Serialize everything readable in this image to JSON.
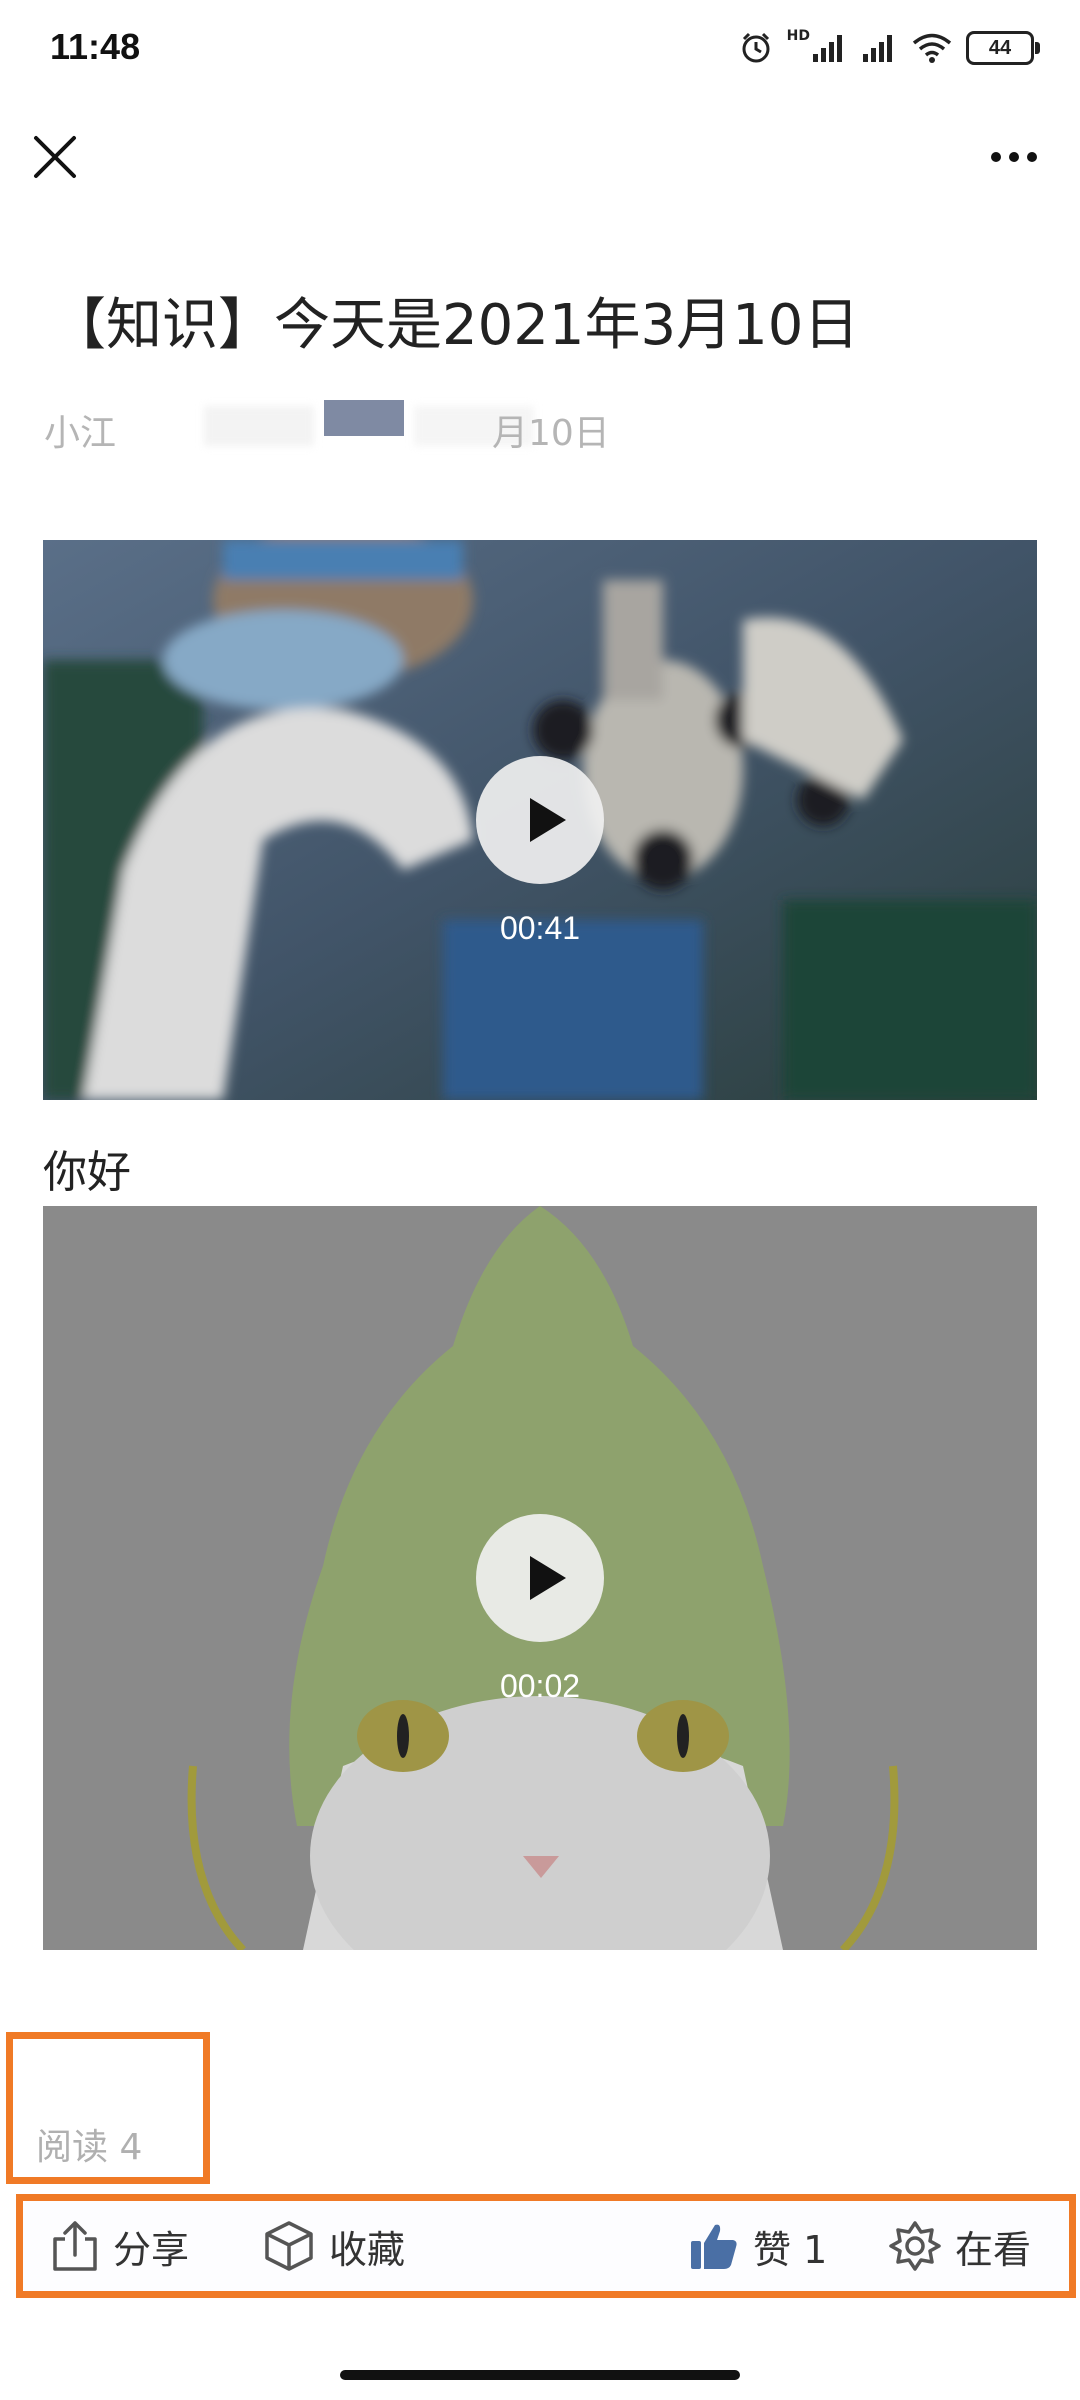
{
  "status_bar": {
    "time": "11:48",
    "hd_label": "HD",
    "battery": "44"
  },
  "header": {
    "close_icon": "close-icon",
    "more_icon": "more-icon"
  },
  "article": {
    "title": "【知识】今天是2021年3月10日",
    "author": "小江",
    "date": "月10日"
  },
  "videos": [
    {
      "duration": "00:41",
      "scene": "surgeon-with-microscope"
    },
    {
      "duration": "00:02",
      "scene": "cat-in-green-hat"
    }
  ],
  "caption": "你好",
  "read_count": "阅读 4",
  "toolbar": {
    "share": "分享",
    "collect": "收藏",
    "like": "赞 1",
    "watching": "在看"
  },
  "colors": {
    "highlight": "#f07a26",
    "like_icon": "#4a6fa5",
    "muted_text": "#b0b0b0"
  }
}
